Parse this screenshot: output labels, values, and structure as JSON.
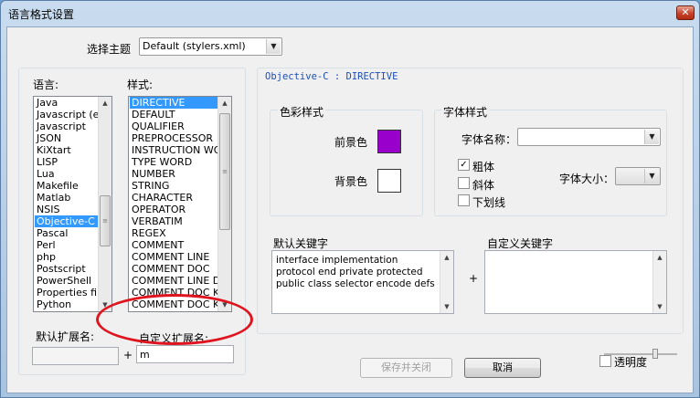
{
  "window": {
    "title": "语言格式设置",
    "close_glyph": "✕"
  },
  "theme": {
    "label": "选择主题",
    "value": "Default (stylers.xml)"
  },
  "language": {
    "label": "语言:",
    "items": [
      "Java",
      "Javascript (em",
      "Javascript",
      "JSON",
      "KiXtart",
      "LISP",
      "Lua",
      "Makefile",
      "Matlab",
      "NSIS",
      "Objective-C",
      "Pascal",
      "Perl",
      "php",
      "Postscript",
      "PowerShell",
      "Properties file",
      "Python"
    ],
    "selected": "Objective-C"
  },
  "style": {
    "label": "样式:",
    "items": [
      "DIRECTIVE",
      "DEFAULT",
      "QUALIFIER",
      "PREPROCESSOR",
      "INSTRUCTION WOI",
      "TYPE WORD",
      "NUMBER",
      "STRING",
      "CHARACTER",
      "OPERATOR",
      "VERBATIM",
      "REGEX",
      "COMMENT",
      "COMMENT LINE",
      "COMMENT DOC",
      "COMMENT LINE DC",
      "COMMENT DOC KE",
      "COMMENT DOC KE"
    ],
    "selected": "DIRECTIVE"
  },
  "ext": {
    "default_label": "默认扩展名:",
    "default_value": "",
    "plus": "+",
    "user_label": "自定义扩展名:",
    "user_value": "m"
  },
  "panel": {
    "title": "Objective-C : DIRECTIVE"
  },
  "colour": {
    "group": "色彩样式",
    "fg_label": "前景色",
    "bg_label": "背景色",
    "fg_color": "#9900cc",
    "bg_color": "#ffffff"
  },
  "font": {
    "group": "字体样式",
    "name_label": "字体名称：",
    "name_value": "",
    "bold_label": "粗体",
    "bold_checked": true,
    "italic_label": "斜体",
    "italic_checked": false,
    "underline_label": "下划线",
    "underline_checked": false,
    "size_label": "字体大小：",
    "size_value": ""
  },
  "keywords": {
    "default_label": "默认关键字",
    "default_text": "interface implementation protocol end private protected public class selector encode defs",
    "plus": "+",
    "user_label": "自定义关键字",
    "user_text": ""
  },
  "buttons": {
    "save_close": "保存并关闭",
    "cancel": "取消"
  },
  "transparency": {
    "label": "透明度",
    "checked": false,
    "level": 0.7
  },
  "icons": {
    "check": "✓",
    "arrow_down": "▼",
    "arrow_up": "▲",
    "grip": "≡"
  }
}
